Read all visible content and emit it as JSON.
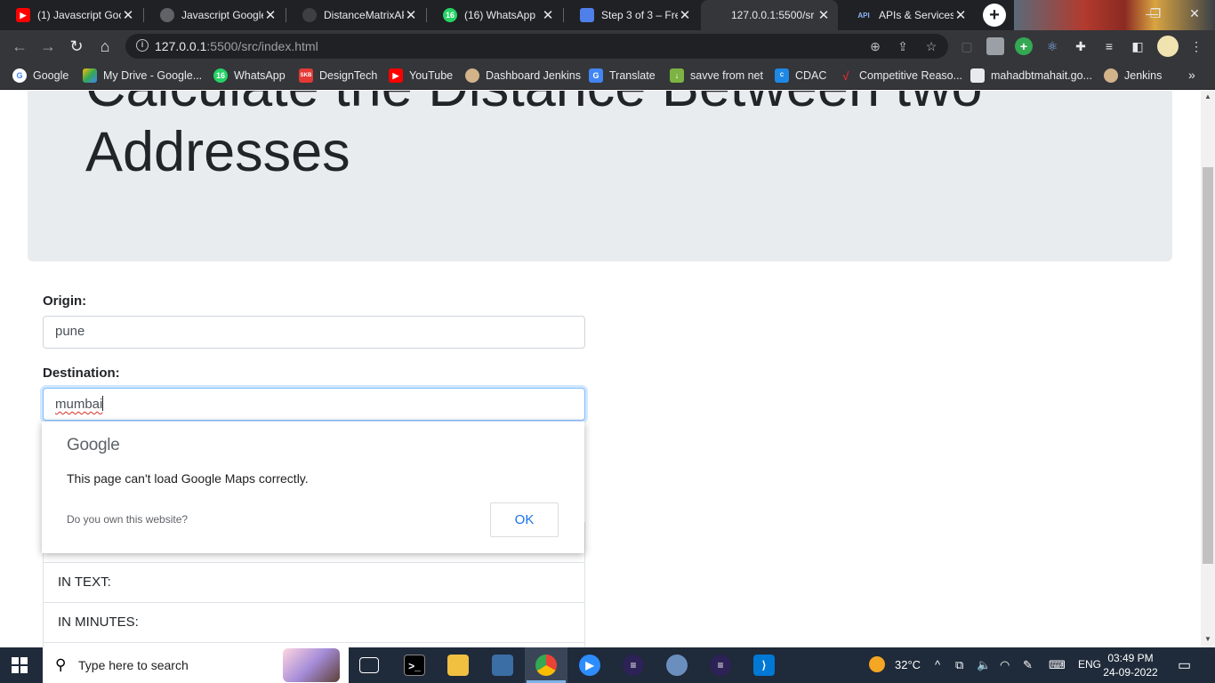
{
  "browser": {
    "tabs": [
      {
        "label": "(1) Javascript Goo",
        "icon": "youtube-icon",
        "color": "#ff0000"
      },
      {
        "label": "Javascript Google",
        "icon": "globe-icon",
        "color": "#9aa0a6"
      },
      {
        "label": "DistanceMatrixAP",
        "icon": "github-icon",
        "color": "#5f6368"
      },
      {
        "label": "(16) WhatsApp",
        "icon": "whatsapp-icon",
        "color": "#25d366"
      },
      {
        "label": "Step 3 of 3 – Free",
        "icon": "form-icon",
        "color": "#4f7fe8"
      },
      {
        "label": "127.0.0.1:5500/sr",
        "icon": "",
        "color": ""
      },
      {
        "label": "APIs & Services –",
        "icon": "api-icon",
        "color": "#8ab4f8"
      }
    ],
    "url_host": "127.0.0.1",
    "url_rest": ":5500/src/index.html",
    "bookmarks": [
      {
        "label": "Google",
        "icon": "google-icon",
        "color": "#ffffff"
      },
      {
        "label": "My Drive - Google...",
        "icon": "drive-icon",
        "color": "#fbbc04"
      },
      {
        "label": "WhatsApp",
        "icon": "whatsapp-icon",
        "color": "#25d366"
      },
      {
        "label": "DesignTech",
        "icon": "designtech-icon",
        "color": "#e53935"
      },
      {
        "label": "YouTube",
        "icon": "youtube-icon",
        "color": "#ff0000"
      },
      {
        "label": "Dashboard Jenkins",
        "icon": "jenkins-icon",
        "color": "#d3b38a"
      },
      {
        "label": "Translate",
        "icon": "translate-icon",
        "color": "#4285f4"
      },
      {
        "label": "savve from net",
        "icon": "download-icon",
        "color": "#7cb342"
      },
      {
        "label": "CDAC",
        "icon": "cdac-icon",
        "color": "#1e88e5"
      },
      {
        "label": "Competitive Reaso...",
        "icon": "competitive-icon",
        "color": "#d32f2f"
      },
      {
        "label": "mahadbtmahait.go...",
        "icon": "document-icon",
        "color": "#e8eaed"
      },
      {
        "label": "Jenkins",
        "icon": "jenkins-icon",
        "color": "#d3b38a"
      }
    ]
  },
  "page": {
    "title": "Calculate the Distance Between two Addresses",
    "origin_label": "Origin:",
    "origin_value": "pune",
    "destination_label": "Destination:",
    "destination_value": "mumbai",
    "result_in_text": "IN TEXT:",
    "result_in_minutes": "IN MINUTES:"
  },
  "maps_error": {
    "logo": "Google",
    "message": "This page can't load Google Maps correctly.",
    "own_website": "Do you own this website?",
    "ok_label": "OK"
  },
  "taskbar": {
    "search_placeholder": "Type here to search",
    "weather": "32°C",
    "language": "ENG",
    "time": "03:49 PM",
    "date": "24-09-2022"
  }
}
